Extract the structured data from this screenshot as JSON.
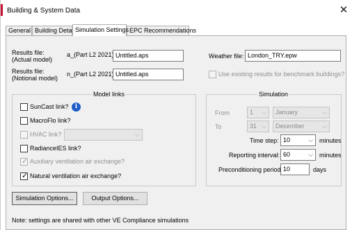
{
  "window": {
    "title": "Building & System Data",
    "close_glyph": "✕"
  },
  "tabs": [
    {
      "label": "General"
    },
    {
      "label": "Building Details"
    },
    {
      "label": "Simulation Settings",
      "active": true
    },
    {
      "label": "EPC Recommendations"
    }
  ],
  "results": {
    "actual": {
      "label_line1": "Results file:",
      "label_line2": "(Actual model)",
      "prefix": "a_(Part L2 2021)_",
      "value": "Untitled.aps"
    },
    "notional": {
      "label_line1": "Results file:",
      "label_line2": "(Notional model)",
      "prefix": "n_(Part L2 2021)_",
      "value": "Untitled.aps"
    }
  },
  "weather": {
    "label": "Weather file:",
    "value": "London_TRY.epw"
  },
  "benchmark": {
    "label": "Use existing results for benchmark buildings?",
    "checked": false,
    "disabled": true
  },
  "model_links": {
    "title": "Model links",
    "suncast": {
      "label": "SunCast link?",
      "checked": false,
      "info_glyph": "i"
    },
    "macroflo": {
      "label": "MacroFlo link?",
      "checked": false
    },
    "hvac": {
      "label": "HVAC link?",
      "checked": false,
      "disabled": true,
      "select_value": ""
    },
    "radiance": {
      "label": "RadianceIES link?",
      "checked": false
    },
    "auxiliary": {
      "label": "Auxiliary ventilation air exchange?",
      "checked": true,
      "disabled": true
    },
    "natural": {
      "label": "Natural ventilation air exchange?",
      "checked": true
    }
  },
  "simulation": {
    "title": "Simulation",
    "from": {
      "label": "From",
      "day": "1",
      "month": "January"
    },
    "to": {
      "label": "To",
      "day": "31",
      "month": "December"
    },
    "time_step": {
      "label": "Time step:",
      "value": "10",
      "unit": "minutes"
    },
    "reporting": {
      "label": "Reporting interval:",
      "value": "60",
      "unit": "minutes"
    },
    "preconditioning": {
      "label": "Preconditioning period:",
      "value": "10",
      "unit": "days"
    }
  },
  "buttons": {
    "simulation_options": "Simulation Options...",
    "output_options": "Output Options..."
  },
  "note": "Note: settings are shared with other VE Compliance simulations",
  "icons": {
    "dropdown": "chevron-down-icon",
    "check": "✓",
    "arrow_glyph": "⌵"
  },
  "colors": {
    "info_blue": "#1e5bc6",
    "panel_bg": "#f0f0f0"
  }
}
